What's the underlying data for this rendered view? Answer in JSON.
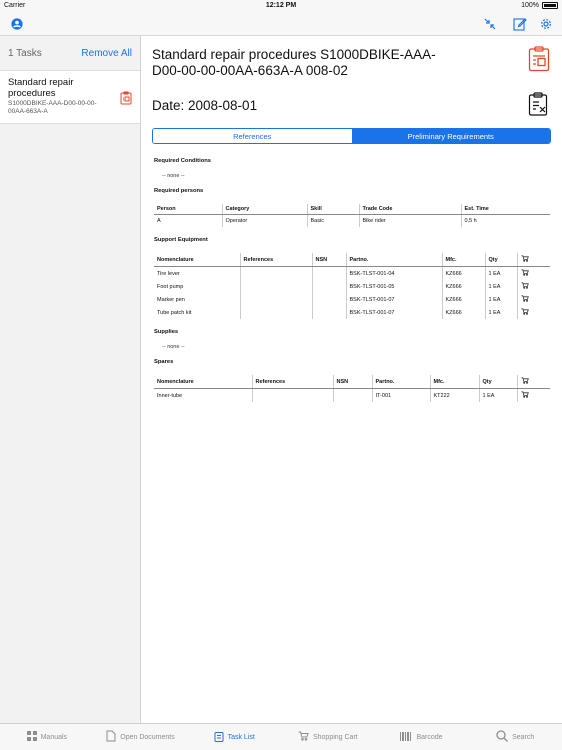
{
  "status": {
    "carrier": "Carrier",
    "time": "12:12 PM",
    "battery": "100%"
  },
  "nav": {
    "icons": [
      "user-icon",
      "collapse-icon",
      "edit-icon",
      "settings-icon"
    ]
  },
  "sidebar": {
    "count": "1 Tasks",
    "remove_all": "Remove All",
    "task": {
      "title": "Standard repair procedures",
      "code": "S1000DBIKE-AAA-D00-00-00-00AA-663A-A"
    }
  },
  "doc": {
    "title": "Standard repair procedures S1000DBIKE-AAA-D00-00-00-00AA-663A-A 008-02",
    "date": "Date: 2008-08-01"
  },
  "segment": {
    "references": "References",
    "preliminary": "Preliminary Requirements"
  },
  "sections": {
    "required_conditions": {
      "title": "Required Conditions",
      "none": "-- none --"
    },
    "required_persons": {
      "title": "Required persons",
      "headers": [
        "Person",
        "Category",
        "Skill",
        "Trade Code",
        "Est. Time"
      ],
      "rows": [
        [
          "A",
          "Operator",
          "Basic",
          "Bike rider",
          "0,5 h"
        ]
      ]
    },
    "support_equipment": {
      "title": "Support Equipment",
      "headers": [
        "Nomenclature",
        "References",
        "NSN",
        "Partno.",
        "Mfc.",
        "Qty"
      ],
      "rows": [
        [
          "Tire lever",
          "",
          "",
          "BSK-TLST-001-04",
          "KZ666",
          "1 EA"
        ],
        [
          "Foot pump",
          "",
          "",
          "BSK-TLST-001-05",
          "KZ666",
          "1 EA"
        ],
        [
          "Marker pen",
          "",
          "",
          "BSK-TLST-001-07",
          "KZ666",
          "1 EA"
        ],
        [
          "Tube patch kit",
          "",
          "",
          "BSK-TLST-001-07",
          "KZ666",
          "1 EA"
        ]
      ]
    },
    "supplies": {
      "title": "Supplies",
      "none": "-- none --"
    },
    "spares": {
      "title": "Spares",
      "headers": [
        "Nomenclature",
        "References",
        "NSN",
        "Partno.",
        "Mfc.",
        "Qty"
      ],
      "rows": [
        [
          "Inner-tube",
          "",
          "",
          "IT-001",
          "KT222",
          "1 EA"
        ]
      ]
    }
  },
  "tabs": [
    {
      "label": "Manuals",
      "icon": "grid-icon",
      "active": false
    },
    {
      "label": "Open Documents",
      "icon": "document-icon",
      "active": false
    },
    {
      "label": "Task List",
      "icon": "task-list-icon",
      "active": true
    },
    {
      "label": "Shopping Cart",
      "icon": "cart-icon",
      "active": false
    },
    {
      "label": "Barcode",
      "icon": "barcode-icon",
      "active": false
    },
    {
      "label": "Search",
      "icon": "search-icon",
      "active": false
    }
  ],
  "colors": {
    "accent": "#1a73e8",
    "alert": "#e8452c"
  }
}
